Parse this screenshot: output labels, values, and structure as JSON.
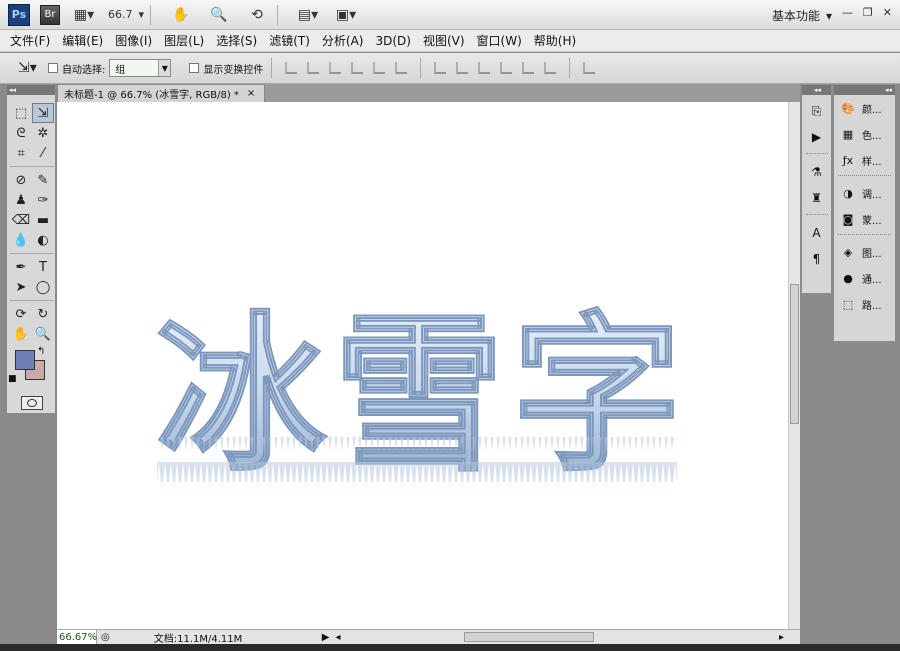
{
  "titlebar": {
    "ps_logo": "Ps",
    "br_logo": "Br",
    "zoom_value": "66.7",
    "workspace": "基本功能"
  },
  "menu": [
    "文件(F)",
    "编辑(E)",
    "图像(I)",
    "图层(L)",
    "选择(S)",
    "滤镜(T)",
    "分析(A)",
    "3D(D)",
    "视图(V)",
    "窗口(W)",
    "帮助(H)"
  ],
  "options": {
    "auto_select_label": "自动选择:",
    "auto_select_value": "组",
    "show_transform_label": "显示变换控件"
  },
  "document": {
    "tab_title": "未标题-1 @ 66.7% (冰雪字, RGB/8) *",
    "tab_close": "×",
    "artwork_text": "冰雪字"
  },
  "status": {
    "zoom": "66.67%",
    "doc_size": "文档:11.1M/4.11M"
  },
  "colors": {
    "foreground": "#6f80b6",
    "background": "#c9a9a9"
  },
  "right_panel": {
    "items": [
      "颜...",
      "色...",
      "样...",
      "调...",
      "蒙...",
      "图...",
      "通...",
      "路..."
    ]
  },
  "dock_icons": [
    "history-icon",
    "actions-icon",
    "tool-presets-icon",
    "clone-source-icon",
    "character-icon",
    "paragraph-icon"
  ]
}
